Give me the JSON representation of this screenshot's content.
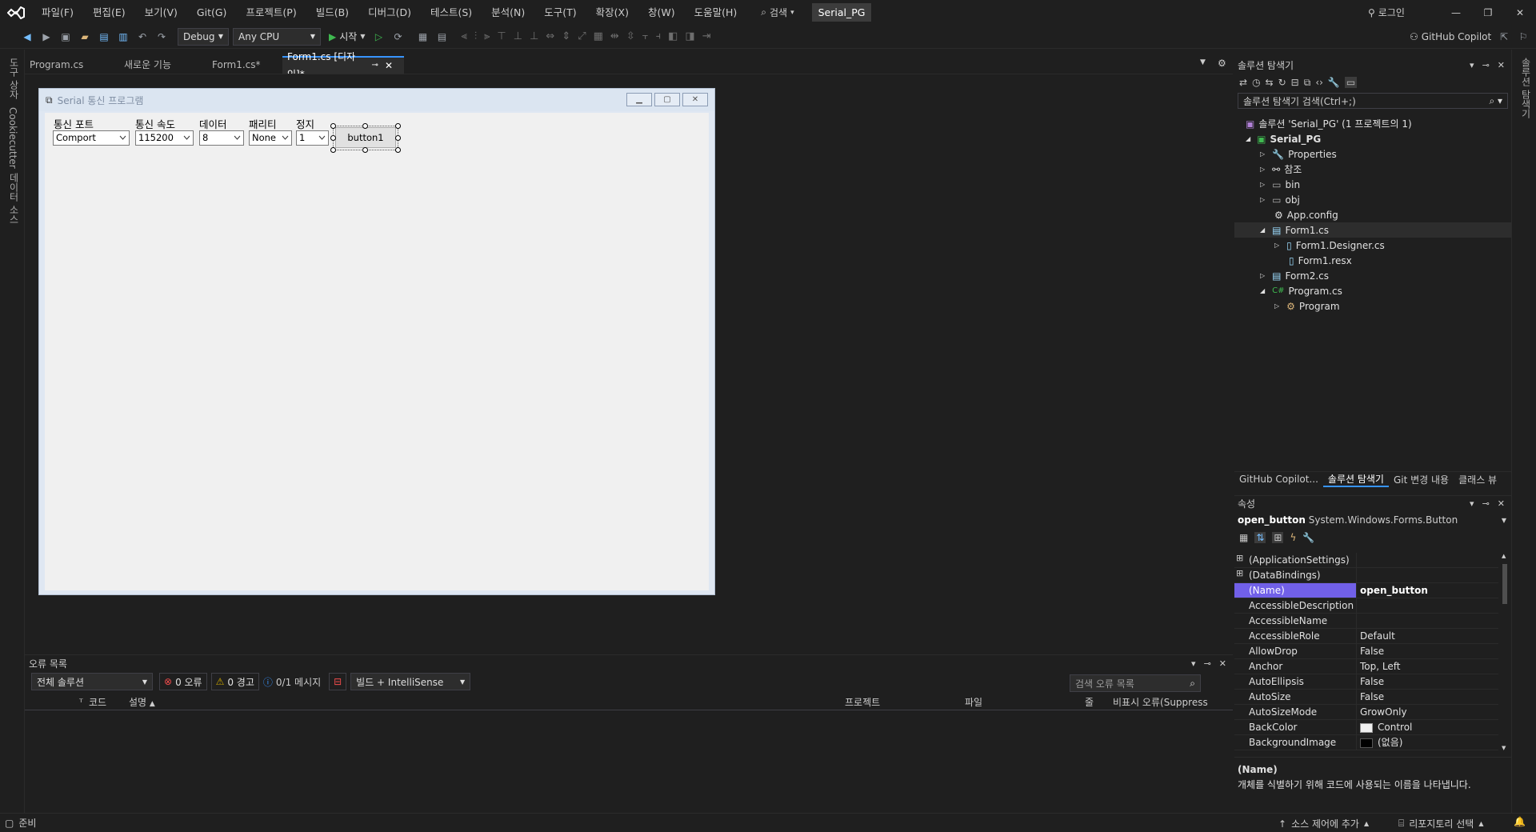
{
  "titlebar": {
    "menus": [
      "파일(F)",
      "편집(E)",
      "보기(V)",
      "Git(G)",
      "프로젝트(P)",
      "빌드(B)",
      "디버그(D)",
      "테스트(S)",
      "분석(N)",
      "도구(T)",
      "확장(X)",
      "창(W)",
      "도움말(H)"
    ],
    "search_label": "검색",
    "project_name": "Serial_PG",
    "login_label": "로그인"
  },
  "toolbar": {
    "config": "Debug",
    "platform": "Any CPU",
    "start_label": "시작",
    "copilot_label": "GitHub Copilot"
  },
  "left_strip": {
    "items": [
      "도구 상자",
      "Cookiecutter",
      "데이터 소스"
    ]
  },
  "right_strip": {
    "items": [
      "솔루션 탐색기"
    ]
  },
  "tabs": [
    {
      "label": "Program.cs"
    },
    {
      "label": "새로운 기능"
    },
    {
      "label": "Form1.cs*"
    },
    {
      "label": "Form1.cs [디자인]*"
    }
  ],
  "form": {
    "title": "Serial 통신 프로그램",
    "labels": [
      "통신 포트",
      "통신 속도",
      "데이터",
      "패리티",
      "정지"
    ],
    "combos": [
      "Comport",
      "115200",
      "8",
      "None",
      "1"
    ],
    "button_text": "button1"
  },
  "error_list": {
    "title": "오류 목록",
    "scope": "전체 솔루션",
    "errors": "0 오류",
    "warnings": "0 경고",
    "messages": "0/1 메시지",
    "build_filter": "빌드 + IntelliSense",
    "search_placeholder": "검색 오류 목록",
    "columns": [
      "코드",
      "설명",
      "프로젝트",
      "파일",
      "줄",
      "비표시 오류(Suppress"
    ]
  },
  "solution_explorer": {
    "title": "솔루션 탐색기",
    "search_placeholder": "솔루션 탐색기 검색(Ctrl+;)",
    "solution": "솔루션 'Serial_PG' (1 프로젝트의 1)",
    "project": "Serial_PG",
    "items": [
      "Properties",
      "참조",
      "bin",
      "obj",
      "App.config",
      "Form1.cs",
      "Form1.Designer.cs",
      "Form1.resx",
      "Form2.cs",
      "Program.cs",
      "Program"
    ],
    "bottom_tabs": [
      "GitHub Copilot...",
      "솔루션 탐색기",
      "Git 변경 내용",
      "클래스 뷰"
    ]
  },
  "properties": {
    "title": "속성",
    "object_name": "open_button",
    "object_type": "System.Windows.Forms.Button",
    "rows": [
      {
        "name": "(ApplicationSettings)",
        "value": ""
      },
      {
        "name": "(DataBindings)",
        "value": ""
      },
      {
        "name": "(Name)",
        "value": "open_button"
      },
      {
        "name": "AccessibleDescription",
        "value": ""
      },
      {
        "name": "AccessibleName",
        "value": ""
      },
      {
        "name": "AccessibleRole",
        "value": "Default"
      },
      {
        "name": "AllowDrop",
        "value": "False"
      },
      {
        "name": "Anchor",
        "value": "Top, Left"
      },
      {
        "name": "AutoEllipsis",
        "value": "False"
      },
      {
        "name": "AutoSize",
        "value": "False"
      },
      {
        "name": "AutoSizeMode",
        "value": "GrowOnly"
      },
      {
        "name": "BackColor",
        "value": "Control"
      },
      {
        "name": "BackgroundImage",
        "value": "(없음)"
      }
    ],
    "desc_title": "(Name)",
    "desc_text": "개체를 식별하기 위해 코드에 사용되는 이름을 나타냅니다."
  },
  "statusbar": {
    "ready": "준비",
    "source_control": "소스 제어에 추가",
    "repo": "리포지토리 선택"
  },
  "colors": {
    "accent": "#3794ff",
    "selection": "#5d5fef",
    "vs_purple": "#7160e8"
  }
}
